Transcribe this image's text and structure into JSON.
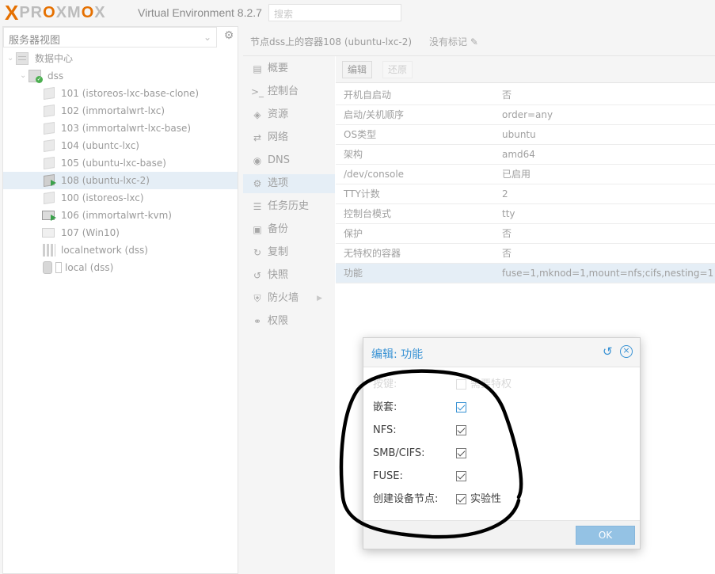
{
  "header": {
    "logo_x": "X",
    "logo_text_pre": "PR",
    "logo_text_o1": "O",
    "logo_text_mid": "XM",
    "logo_text_o2": "O",
    "logo_text_post": "X",
    "version": "Virtual Environment 8.2.7",
    "search_placeholder": "搜索"
  },
  "left_panel": {
    "view_label": "服务器视图",
    "tree": {
      "datacenter": "数据中心",
      "node": "dss",
      "items": [
        {
          "label": "101 (istoreos-lxc-base-clone)",
          "kind": "ct",
          "running": false
        },
        {
          "label": "102 (immortalwrt-lxc)",
          "kind": "ct",
          "running": false
        },
        {
          "label": "103 (immortalwrt-lxc-base)",
          "kind": "ct",
          "running": false
        },
        {
          "label": "104 (ubuntc-lxc)",
          "kind": "ct",
          "running": false
        },
        {
          "label": "105 (ubuntu-lxc-base)",
          "kind": "ct",
          "running": false
        },
        {
          "label": "108 (ubuntu-lxc-2)",
          "kind": "ct",
          "running": true
        },
        {
          "label": "100 (istoreos-lxc)",
          "kind": "ct",
          "running": false
        },
        {
          "label": "106 (immortalwrt-kvm)",
          "kind": "vm",
          "running": true
        },
        {
          "label": "107 (Win10)",
          "kind": "vm",
          "running": false
        },
        {
          "label": "localnetwork (dss)",
          "kind": "net",
          "running": false
        },
        {
          "label": "local (dss)",
          "kind": "storage",
          "running": false
        }
      ]
    }
  },
  "content": {
    "title": "节点dss上的容器108 (ubuntu-lxc-2)",
    "tag_text": "没有标记",
    "nav": [
      {
        "label": "概要",
        "icon": "book-icon"
      },
      {
        "label": "控制台",
        "icon": "terminal-icon"
      },
      {
        "label": "资源",
        "icon": "cube-icon"
      },
      {
        "label": "网络",
        "icon": "exchange-icon"
      },
      {
        "label": "DNS",
        "icon": "globe-icon"
      },
      {
        "label": "选项",
        "icon": "gear-icon"
      },
      {
        "label": "任务历史",
        "icon": "list-icon"
      },
      {
        "label": "备份",
        "icon": "floppy-icon"
      },
      {
        "label": "复制",
        "icon": "retweet-icon"
      },
      {
        "label": "快照",
        "icon": "history-icon"
      },
      {
        "label": "防火墙",
        "icon": "shield-icon"
      },
      {
        "label": "权限",
        "icon": "unlock-icon"
      }
    ],
    "toolbar": {
      "edit": "编辑",
      "revert": "还原"
    },
    "options": [
      {
        "key": "开机自启动",
        "value": "否"
      },
      {
        "key": "启动/关机顺序",
        "value": "order=any"
      },
      {
        "key": "OS类型",
        "value": "ubuntu"
      },
      {
        "key": "架构",
        "value": "amd64"
      },
      {
        "key": "/dev/console",
        "value": "已启用"
      },
      {
        "key": "TTY计数",
        "value": "2"
      },
      {
        "key": "控制台模式",
        "value": "tty"
      },
      {
        "key": "保护",
        "value": "否"
      },
      {
        "key": "无特权的容器",
        "value": "否"
      },
      {
        "key": "功能",
        "value": "fuse=1,mknod=1,mount=nfs;cifs,nesting=1"
      }
    ]
  },
  "dialog": {
    "title": "编辑: 功能",
    "fields": [
      {
        "label": "按键:",
        "checked": false,
        "extra": "需要特权",
        "disabled": true
      },
      {
        "label": "嵌套:",
        "checked": true,
        "extra": "",
        "disabled": false,
        "focus": true
      },
      {
        "label": "NFS:",
        "checked": true,
        "extra": "",
        "disabled": false
      },
      {
        "label": "SMB/CIFS:",
        "checked": true,
        "extra": "",
        "disabled": false
      },
      {
        "label": "FUSE:",
        "checked": true,
        "extra": "",
        "disabled": false
      },
      {
        "label": "创建设备节点:",
        "checked": true,
        "extra": "实验性",
        "disabled": false
      }
    ],
    "ok": "OK"
  },
  "colors": {
    "brand_orange": "#e57000",
    "accent_blue": "#3892d4",
    "selection": "#e5eef6",
    "annotation_stroke": "#000000"
  }
}
